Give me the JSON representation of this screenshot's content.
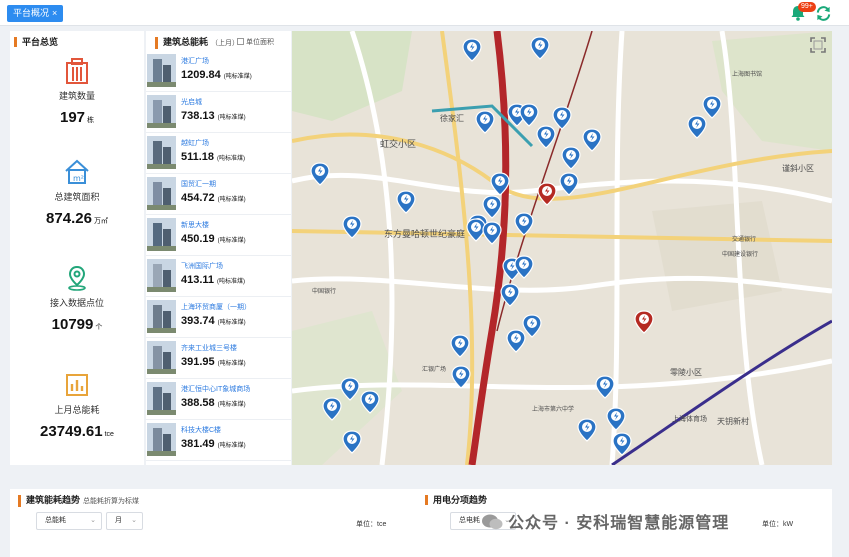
{
  "topbar": {
    "tab_label": "平台概况",
    "tab_close": "×",
    "notification_badge": "99+"
  },
  "overview": {
    "title": "平台总览",
    "stats": [
      {
        "label": "建筑数量",
        "value": "197",
        "unit": "栋",
        "icon": "building-icon"
      },
      {
        "label": "总建筑面积",
        "value": "874.26",
        "unit": "万㎡",
        "icon": "area-house-icon"
      },
      {
        "label": "接入数据点位",
        "value": "10799",
        "unit": "个",
        "icon": "location-pin-icon"
      },
      {
        "label": "上月总能耗",
        "value": "23749.61",
        "unit": "tce",
        "icon": "bar-chart-icon"
      }
    ]
  },
  "energy": {
    "title": "建筑总能耗",
    "period": "（上月）",
    "unit_area_label": "单位面积",
    "value_unit": "(吨标准煤)",
    "buildings": [
      {
        "name": "港汇广场",
        "value": "1209.84"
      },
      {
        "name": "光启城",
        "value": "738.13"
      },
      {
        "name": "越虹广场",
        "value": "511.18"
      },
      {
        "name": "国贸汇一期",
        "value": "454.72"
      },
      {
        "name": "新思大楼",
        "value": "450.19"
      },
      {
        "name": "飞洲国际广场",
        "value": "413.11"
      },
      {
        "name": "上海环贸商厦（一期）",
        "value": "393.74"
      },
      {
        "name": "齐来工业城三号楼",
        "value": "391.95"
      },
      {
        "name": "港汇恒中心IT象城商场",
        "value": "388.58"
      },
      {
        "name": "科技大楼C楼",
        "value": "381.49"
      }
    ]
  },
  "map": {
    "labels": [
      "虹交小区",
      "东方曼哈顿世纪豪庭",
      "徐家汇",
      "谨斜小区",
      "零陵小区",
      "上海体育场",
      "天钥新村",
      "上海图书馆",
      "中国建设银行",
      "交通银行",
      "中国银行",
      "上海市第六中学",
      "汇银广场"
    ],
    "markers_normal": 36,
    "markers_alert": 2
  },
  "trend": {
    "title": "建筑能耗趋势",
    "subtitle": "总能耗折算为标煤",
    "metric_select": "总能耗",
    "period_select": "月",
    "unit_label": "单位：",
    "unit_value": "tce"
  },
  "usage": {
    "title": "用电分项趋势",
    "metric_select": "总电耗",
    "unit_label": "单位：",
    "unit_value": "kW"
  },
  "watermark": "公众号 · 安科瑞智慧能源管理",
  "colors": {
    "accent_orange": "#e57a23",
    "tab_blue": "#2d8cf0",
    "marker_blue": "#2a73c4",
    "marker_alert": "#b52a22",
    "metro_red": "#b3262a",
    "link_blue": "#2d7be0"
  }
}
